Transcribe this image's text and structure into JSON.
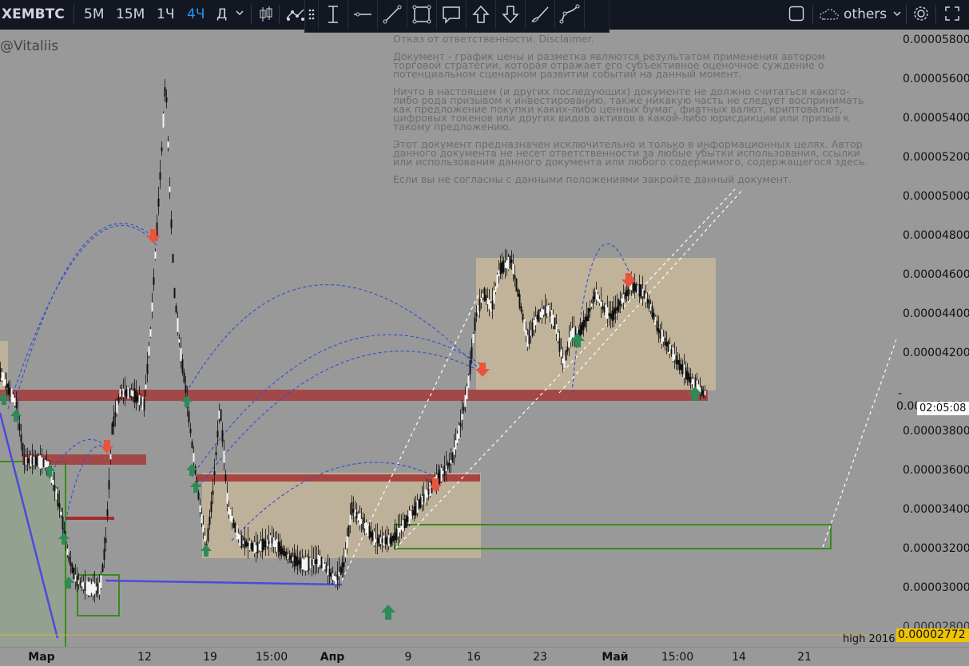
{
  "toolbar": {
    "symbol": "XEMBTC",
    "intervals": [
      "5М",
      "15М",
      "1Ч",
      "4Ч",
      "Д"
    ],
    "active_interval": "4Ч",
    "compare_label": "others",
    "icons": {
      "chevron": "chevron-down-icon",
      "candles": "candlestick-icon",
      "indicators": "indicators-icon",
      "settings": "gear-icon",
      "fullscreen": "fullscreen-icon"
    }
  },
  "drawing_tools": [
    "grip-icon",
    "cursor-text-icon",
    "horizontal-line-icon",
    "trend-line-icon",
    "rectangle-icon",
    "callout-icon",
    "arrow-up-icon",
    "arrow-down-icon",
    "brush-icon",
    "path-icon"
  ],
  "watermark": "@Vitaliis",
  "disclaimer": [
    "Отказ от ответственности. Disclaimer.",
    "Документ - график цены и разметка являются результатом применения автором торговой стратегии, которая отражает его субъективное оценочное суждение о потенциальном сценарном развитии событий на данный момент.",
    "Ничто в настоящем (и других последующих) документе не должно считаться какого-либо рода призывом к инвестированию, также никакую часть не следует воспринимать как предложение покупки каких-либо ценных бумаг, фиатных валют, криптовалют, цифровых токенов или других видов активов в какой-либо юрисдикции или призыв к такому предложению.",
    "Этот документ предназначен исключительно и только в информационных целях. Автор данного документа не несет ответственности за любые убытки использования, ссылки или использования данного документа или любого содержимого, содержащегося здесь.",
    "Если вы не согласны с данными положениями закройте данный документ."
  ],
  "price_axis": {
    "labels": [
      "0.00005800",
      "0.00005600",
      "0.00005400",
      "0.00005200",
      "0.00005000",
      "0.00004800",
      "0.00004600",
      "0.00004400",
      "0.00004200",
      "0.00003800",
      "0.00003600",
      "0.00003400",
      "0.00003200",
      "0.00003000",
      "0.00002800"
    ],
    "current_price": "0.00003988",
    "countdown": "02:05:08",
    "high_label": "high 2016",
    "high_value": "0.00002772"
  },
  "time_axis": [
    {
      "label": "Мар",
      "bold": true
    },
    {
      "label": "12",
      "bold": false
    },
    {
      "label": "19",
      "bold": false
    },
    {
      "label": "15:00",
      "bold": false
    },
    {
      "label": "Апр",
      "bold": true
    },
    {
      "label": "9",
      "bold": false
    },
    {
      "label": "16",
      "bold": false
    },
    {
      "label": "23",
      "bold": false
    },
    {
      "label": "Май",
      "bold": true
    },
    {
      "label": "15:00",
      "bold": false
    },
    {
      "label": "14",
      "bold": false
    },
    {
      "label": "21",
      "bold": false
    }
  ],
  "colors": {
    "background": "#999999",
    "toolbar": "#131722",
    "active_interval": "#2196f3",
    "resistance": "#a53a3a",
    "zone": "#c9b99a",
    "box": "#3a8a1a",
    "trendline": "#4b4bdc",
    "arrow_up": "#2e8b57",
    "arrow_down": "#e8553c",
    "high_line": "#d4b03a"
  }
}
